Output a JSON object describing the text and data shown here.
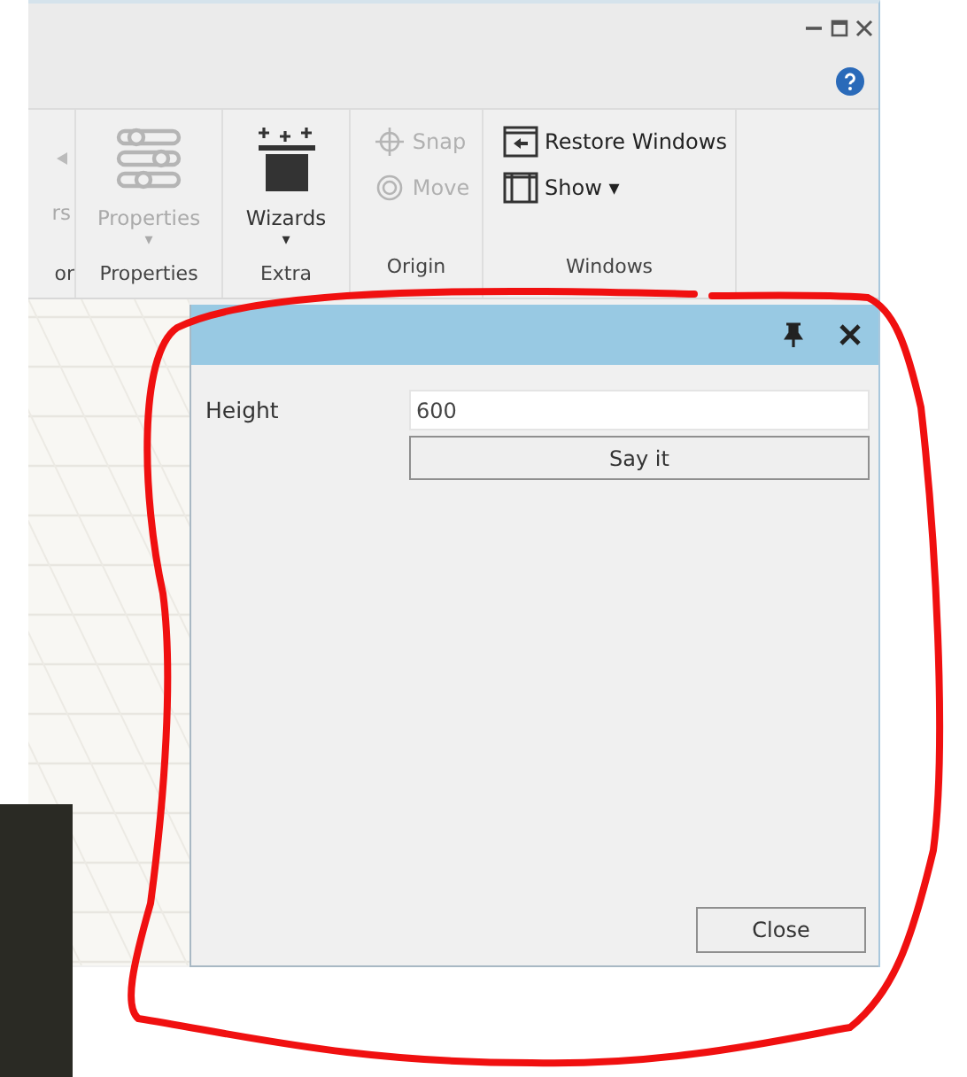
{
  "ribbon": {
    "groups": [
      {
        "label": "or",
        "buttons": [
          {
            "kind": "large",
            "label": "rs",
            "disabled": true
          }
        ]
      },
      {
        "label": "Properties",
        "buttons": [
          {
            "kind": "large",
            "label": "Properties",
            "disabled": true,
            "dropdown": "▾"
          }
        ]
      },
      {
        "label": "Extra",
        "buttons": [
          {
            "kind": "large",
            "label": "Wizards",
            "disabled": false,
            "dropdown": "▾"
          }
        ]
      },
      {
        "label": "Origin",
        "buttons": [
          {
            "kind": "small",
            "label": "Snap",
            "disabled": true
          },
          {
            "kind": "small",
            "label": "Move",
            "disabled": true
          }
        ]
      },
      {
        "label": "Windows",
        "buttons": [
          {
            "kind": "small",
            "label": "Restore Windows",
            "disabled": false
          },
          {
            "kind": "small",
            "label": "Show ▾",
            "disabled": false
          }
        ]
      }
    ]
  },
  "panel": {
    "fields": [
      {
        "label": "Height",
        "value": "600"
      }
    ],
    "action_button": "Say it",
    "close_button": "Close"
  }
}
